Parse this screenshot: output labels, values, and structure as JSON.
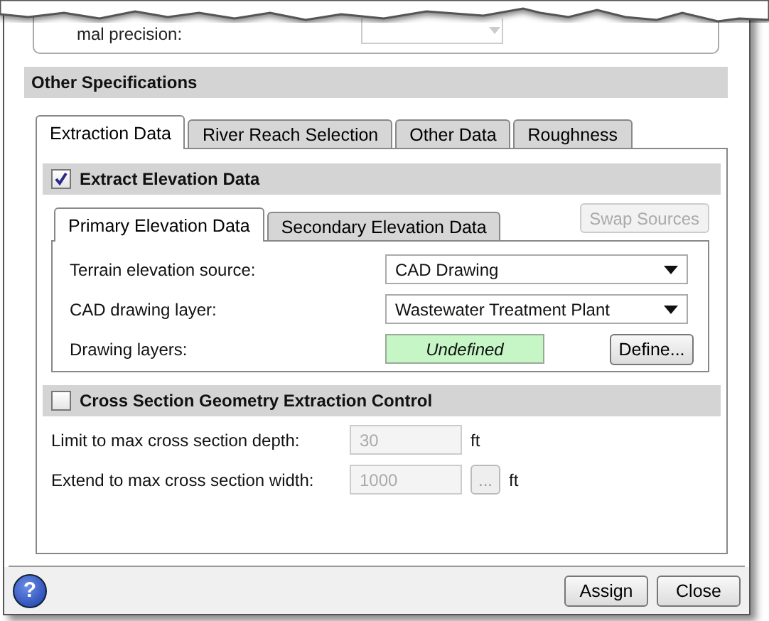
{
  "top_fragment": {
    "label": "mal precision:"
  },
  "section": {
    "title": "Other Specifications"
  },
  "tabs": [
    {
      "label": "Extraction Data",
      "selected": true
    },
    {
      "label": "River Reach Selection",
      "selected": false
    },
    {
      "label": "Other Data",
      "selected": false
    },
    {
      "label": "Roughness",
      "selected": false
    }
  ],
  "extract_elevation": {
    "label": "Extract Elevation Data",
    "checked": true
  },
  "inner_tabs": [
    {
      "label": "Primary Elevation Data",
      "selected": true
    },
    {
      "label": "Secondary Elevation Data",
      "selected": false
    }
  ],
  "swap_button": {
    "label": "Swap Sources",
    "disabled": true
  },
  "elevation_fields": [
    {
      "kind": "dropdown",
      "label": "Terrain elevation source:",
      "value": "CAD Drawing"
    },
    {
      "kind": "dropdown",
      "label": "CAD drawing layer:",
      "value": "Wastewater Treatment Plant"
    },
    {
      "kind": "status",
      "label": "Drawing layers:",
      "value": "Undefined",
      "button": "Define..."
    }
  ],
  "cross_section": {
    "label": "Cross Section Geometry Extraction Control",
    "checked": false
  },
  "limits": [
    {
      "label": "Limit to max cross section depth:",
      "value": "30",
      "unit": "ft",
      "disabled": true
    },
    {
      "label": "Extend to max cross section width:",
      "value": "1000",
      "button": "...",
      "unit": "ft",
      "disabled": true
    }
  ],
  "help": "?",
  "buttons": [
    {
      "label": "Assign"
    },
    {
      "label": "Close"
    }
  ]
}
